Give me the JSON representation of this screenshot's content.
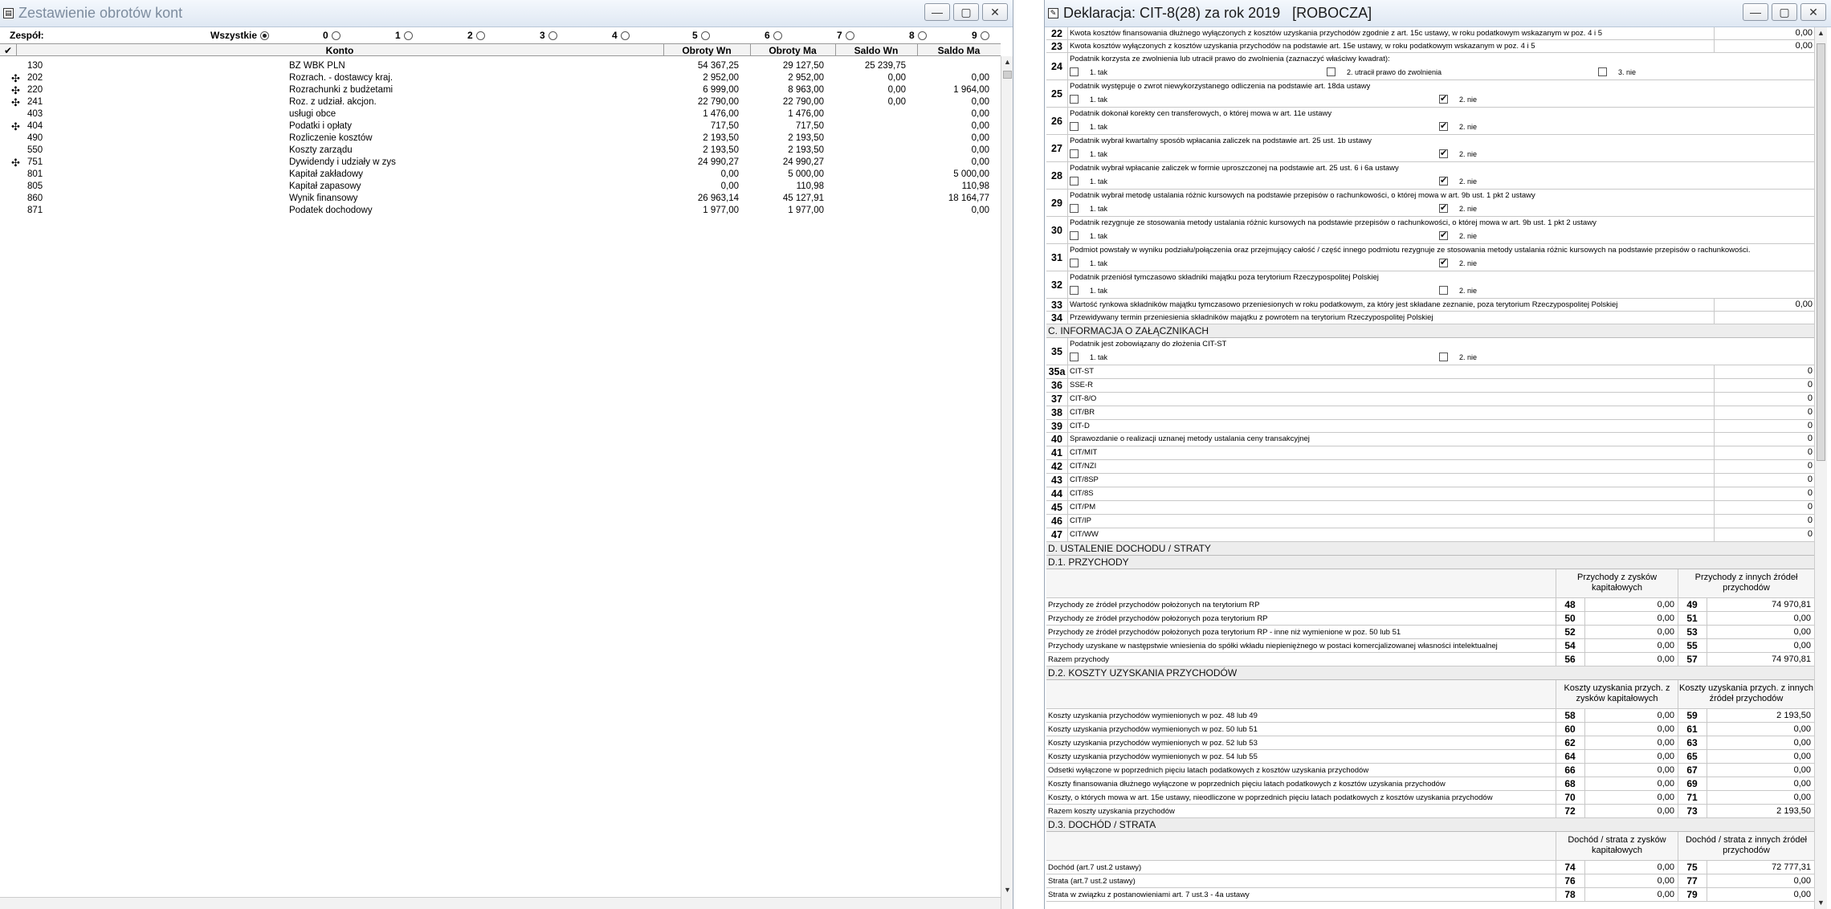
{
  "win1": {
    "title": "Zestawienie obrotów kont",
    "filter": {
      "label": "Zespół:",
      "options": [
        {
          "label": "Wszystkie",
          "selected": true
        },
        {
          "label": "0",
          "selected": false
        },
        {
          "label": "1",
          "selected": false
        },
        {
          "label": "2",
          "selected": false
        },
        {
          "label": "3",
          "selected": false
        },
        {
          "label": "4",
          "selected": false
        },
        {
          "label": "5",
          "selected": false
        },
        {
          "label": "6",
          "selected": false
        },
        {
          "label": "7",
          "selected": false
        },
        {
          "label": "8",
          "selected": false
        },
        {
          "label": "9",
          "selected": false
        }
      ]
    },
    "columns": {
      "konto": "Konto",
      "obroty_wn": "Obroty Wn",
      "obroty_ma": "Obroty Ma",
      "saldo_wn": "Saldo Wn",
      "saldo_ma": "Saldo Ma"
    },
    "rows": [
      {
        "expand": false,
        "code": "130",
        "name": "BZ WBK PLN",
        "obroty_wn": "54 367,25",
        "obroty_ma": "29 127,50",
        "saldo_wn": "25 239,75",
        "saldo_ma": ""
      },
      {
        "expand": true,
        "code": "202",
        "name": "Rozrach. - dostawcy kraj.",
        "obroty_wn": "2 952,00",
        "obroty_ma": "2 952,00",
        "saldo_wn": "0,00",
        "saldo_ma": "0,00"
      },
      {
        "expand": true,
        "code": "220",
        "name": "Rozrachunki z budżetami",
        "obroty_wn": "6 999,00",
        "obroty_ma": "8 963,00",
        "saldo_wn": "0,00",
        "saldo_ma": "1 964,00"
      },
      {
        "expand": true,
        "code": "241",
        "name": "Roz. z udział. akcjon.",
        "obroty_wn": "22 790,00",
        "obroty_ma": "22 790,00",
        "saldo_wn": "0,00",
        "saldo_ma": "0,00"
      },
      {
        "expand": false,
        "code": "403",
        "name": "usługi obce",
        "obroty_wn": "1 476,00",
        "obroty_ma": "1 476,00",
        "saldo_wn": "",
        "saldo_ma": "0,00"
      },
      {
        "expand": true,
        "code": "404",
        "name": "Podatki i opłaty",
        "obroty_wn": "717,50",
        "obroty_ma": "717,50",
        "saldo_wn": "",
        "saldo_ma": "0,00"
      },
      {
        "expand": false,
        "code": "490",
        "name": "Rozliczenie kosztów",
        "obroty_wn": "2 193,50",
        "obroty_ma": "2 193,50",
        "saldo_wn": "",
        "saldo_ma": "0,00"
      },
      {
        "expand": false,
        "code": "550",
        "name": "Koszty zarządu",
        "obroty_wn": "2 193,50",
        "obroty_ma": "2 193,50",
        "saldo_wn": "",
        "saldo_ma": "0,00"
      },
      {
        "expand": true,
        "code": "751",
        "name": "Dywidendy i udziały w zys",
        "obroty_wn": "24 990,27",
        "obroty_ma": "24 990,27",
        "saldo_wn": "",
        "saldo_ma": "0,00"
      },
      {
        "expand": false,
        "code": "801",
        "name": "Kapitał zakładowy",
        "obroty_wn": "0,00",
        "obroty_ma": "5 000,00",
        "saldo_wn": "",
        "saldo_ma": "5 000,00"
      },
      {
        "expand": false,
        "code": "805",
        "name": "Kapitał zapasowy",
        "obroty_wn": "0,00",
        "obroty_ma": "110,98",
        "saldo_wn": "",
        "saldo_ma": "110,98"
      },
      {
        "expand": false,
        "code": "860",
        "name": "Wynik finansowy",
        "obroty_wn": "26 963,14",
        "obroty_ma": "45 127,91",
        "saldo_wn": "",
        "saldo_ma": "18 164,77"
      },
      {
        "expand": false,
        "code": "871",
        "name": "Podatek dochodowy",
        "obroty_wn": "1 977,00",
        "obroty_ma": "1 977,00",
        "saldo_wn": "",
        "saldo_ma": "0,00"
      }
    ]
  },
  "win2": {
    "title": "Deklaracja: CIT-8(28) za rok 2019   [ROBOCZA]",
    "opt_tak": "1. tak",
    "opt_nie": "2. nie",
    "items_top": [
      {
        "num": "22",
        "text": "Kwota kosztów finansowania dłużnego wyłączonych z kosztów uzyskania przychodów zgodnie z art. 15c ustawy, w roku podatkowym wskazanym w poz. 4 i 5",
        "value": "0,00"
      },
      {
        "num": "23",
        "text": "Kwota kosztów wyłączonych z kosztów uzyskania przychodów na podstawie art. 15e ustawy, w roku podatkowym wskazanym w poz. 4 i 5",
        "value": "0,00"
      }
    ],
    "item24": {
      "num": "24",
      "text": "Podatnik korzysta ze zwolnienia lub utracił prawo do zwolnienia (zaznaczyć właściwy kwadrat):",
      "opt1": "1. tak",
      "opt2": "2. utracił prawo do zwolnienia",
      "opt3": "3. nie"
    },
    "yesno": [
      {
        "num": "25",
        "text": "Podatnik występuje o zwrot niewykorzystanego odliczenia na podstawie art. 18da ustawy",
        "no": true
      },
      {
        "num": "26",
        "text": "Podatnik dokonał korekty cen transferowych, o której mowa w art. 11e ustawy",
        "no": true
      },
      {
        "num": "27",
        "text": "Podatnik wybrał kwartalny sposób wpłacania zaliczek na podstawie art. 25 ust. 1b ustawy",
        "no": true
      },
      {
        "num": "28",
        "text": "Podatnik wybrał wpłacanie zaliczek w formie uproszczonej na podstawie art. 25 ust. 6 i 6a ustawy",
        "no": true
      },
      {
        "num": "29",
        "text": "Podatnik wybrał metodę ustalania różnic kursowych na podstawie przepisów o rachunkowości, o której mowa w art. 9b ust. 1 pkt 2 ustawy",
        "no": true
      },
      {
        "num": "30",
        "text": "Podatnik rezygnuje ze stosowania metody ustalania różnic kursowych na podstawie przepisów o rachunkowości, o której mowa w art. 9b ust. 1 pkt 2 ustawy",
        "no": true
      },
      {
        "num": "31",
        "text": "Podmiot powstały w wyniku podziału/połączenia oraz przejmujący całość / część innego podmiotu rezygnuje ze stosowania metody ustalania różnic kursowych na podstawie przepisów o rachunkowości.",
        "no": true
      },
      {
        "num": "32",
        "text": "Podatnik przeniósł tymczasowo składniki majątku poza terytorium Rzeczypospolitej Polskiej",
        "no": false
      }
    ],
    "items_mid": [
      {
        "num": "33",
        "text": "Wartość rynkowa składników majątku tymczasowo przeniesionych w roku podatkowym, za który jest składane zeznanie, poza terytorium Rzeczypospolitej Polskiej",
        "value": "0,00"
      },
      {
        "num": "34",
        "text": "Przewidywany termin przeniesienia składników majątku z powrotem na terytorium Rzeczypospolitej Polskiej",
        "value": ""
      }
    ],
    "section_c": "C. INFORMACJA O ZAŁĄCZNIKACH",
    "item35": {
      "num": "35",
      "text": "Podatnik jest zobowiązany do złożenia CIT-ST"
    },
    "attachments": [
      {
        "num": "35a",
        "text": "CIT-ST",
        "value": "0"
      },
      {
        "num": "36",
        "text": "SSE-R",
        "value": "0"
      },
      {
        "num": "37",
        "text": "CIT-8/O",
        "value": "0"
      },
      {
        "num": "38",
        "text": "CIT/BR",
        "value": "0"
      },
      {
        "num": "39",
        "text": "CIT-D",
        "value": "0"
      },
      {
        "num": "40",
        "text": "Sprawozdanie o realizacji uznanej metody ustalania ceny transakcyjnej",
        "value": "0"
      },
      {
        "num": "41",
        "text": "CIT/MIT",
        "value": "0"
      },
      {
        "num": "42",
        "text": "CIT/NZI",
        "value": "0"
      },
      {
        "num": "43",
        "text": "CIT/8SP",
        "value": "0"
      },
      {
        "num": "44",
        "text": "CIT/8S",
        "value": "0"
      },
      {
        "num": "45",
        "text": "CIT/PM",
        "value": "0"
      },
      {
        "num": "46",
        "text": "CIT/IP",
        "value": "0"
      },
      {
        "num": "47",
        "text": "CIT/WW",
        "value": "0"
      }
    ],
    "section_d": "D. USTALENIE DOCHODU / STRATY",
    "d1": {
      "title": "D.1. PRZYCHODY",
      "col1": "Przychody z zysków kapitałowych",
      "col2": "Przychody z innych źródeł przychodów",
      "rows": [
        {
          "text": "Przychody ze źródeł przychodów położonych na terytorium RP",
          "n1": "48",
          "v1": "0,00",
          "n2": "49",
          "v2": "74 970,81"
        },
        {
          "text": "Przychody ze źródeł przychodów położonych poza terytorium RP",
          "n1": "50",
          "v1": "0,00",
          "n2": "51",
          "v2": "0,00"
        },
        {
          "text": "Przychody ze źródeł przychodów położonych poza terytorium RP - inne niż wymienione w poz. 50 lub 51",
          "n1": "52",
          "v1": "0,00",
          "n2": "53",
          "v2": "0,00"
        },
        {
          "text": "Przychody uzyskane w następstwie wniesienia do spółki wkładu niepieniężnego w postaci komercjalizowanej własności intelektualnej",
          "n1": "54",
          "v1": "0,00",
          "n2": "55",
          "v2": "0,00"
        },
        {
          "text": "Razem przychody",
          "n1": "56",
          "v1": "0,00",
          "n2": "57",
          "v2": "74 970,81"
        }
      ]
    },
    "d2": {
      "title": "D.2. KOSZTY UZYSKANIA PRZYCHODÓW",
      "col1": "Koszty uzyskania przych. z zysków kapitałowych",
      "col2": "Koszty uzyskania przych. z innych źródeł przychodów",
      "rows": [
        {
          "text": "Koszty uzyskania przychodów wymienionych w poz. 48 lub 49",
          "n1": "58",
          "v1": "0,00",
          "n2": "59",
          "v2": "2 193,50"
        },
        {
          "text": "Koszty uzyskania przychodów wymienionych w poz. 50 lub 51",
          "n1": "60",
          "v1": "0,00",
          "n2": "61",
          "v2": "0,00"
        },
        {
          "text": "Koszty uzyskania przychodów wymienionych w poz. 52 lub 53",
          "n1": "62",
          "v1": "0,00",
          "n2": "63",
          "v2": "0,00"
        },
        {
          "text": "Koszty uzyskania przychodów wymienionych w poz. 54 lub 55",
          "n1": "64",
          "v1": "0,00",
          "n2": "65",
          "v2": "0,00"
        },
        {
          "text": "Odsetki wyłączone w poprzednich pięciu latach podatkowych z kosztów uzyskania przychodów",
          "n1": "66",
          "v1": "0,00",
          "n2": "67",
          "v2": "0,00"
        },
        {
          "text": "Koszty finansowania dłużnego wyłączone w poprzednich pięciu latach podatkowych z kosztów uzyskania przychodów",
          "n1": "68",
          "v1": "0,00",
          "n2": "69",
          "v2": "0,00"
        },
        {
          "text": "Koszty, o których mowa w art. 15e ustawy, nieodliczone w poprzednich pięciu latach podatkowych z kosztów uzyskania przychodów",
          "n1": "70",
          "v1": "0,00",
          "n2": "71",
          "v2": "0,00"
        },
        {
          "text": "Razem koszty uzyskania przychodów",
          "n1": "72",
          "v1": "0,00",
          "n2": "73",
          "v2": "2 193,50"
        }
      ]
    },
    "d3": {
      "title": "D.3. DOCHÓD / STRATA",
      "col1": "Dochód / strata z zysków kapitałowych",
      "col2": "Dochód / strata z innych źródeł przychodów",
      "rows": [
        {
          "text": "Dochód (art.7 ust.2 ustawy)",
          "n1": "74",
          "v1": "0,00",
          "n2": "75",
          "v2": "72 777,31"
        },
        {
          "text": "Strata (art.7 ust.2 ustawy)",
          "n1": "76",
          "v1": "0,00",
          "n2": "77",
          "v2": "0,00"
        },
        {
          "text": "Strata w związku z postanowieniami art. 7 ust.3 - 4a ustawy",
          "n1": "78",
          "v1": "0,00",
          "n2": "79",
          "v2": "0,00"
        }
      ]
    }
  }
}
